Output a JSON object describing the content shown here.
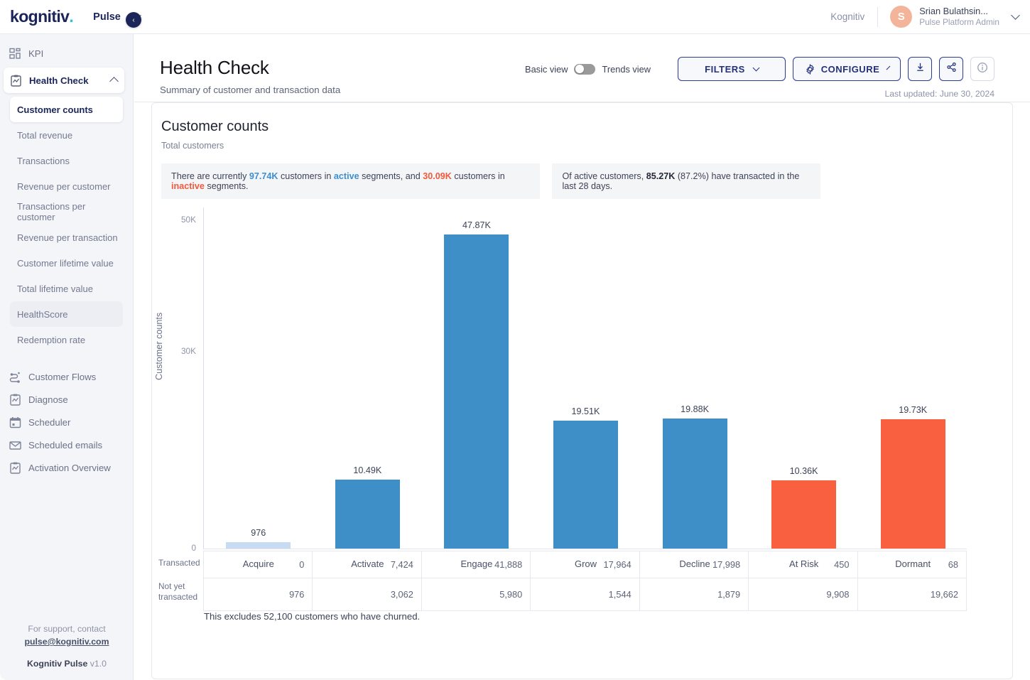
{
  "topbar": {
    "logo_text": "kognitiv",
    "product": "Pulse",
    "org": "Kognitiv",
    "avatar_initial": "S",
    "user_name": "Srian Bulathsin...",
    "user_role": "Pulse Platform Admin"
  },
  "sidebar": {
    "items": [
      {
        "label": "KPI",
        "icon": "grid-icon"
      },
      {
        "label": "Health Check",
        "icon": "clipboard-chart-icon"
      }
    ],
    "subitems": [
      {
        "label": "Customer counts",
        "state": "selected"
      },
      {
        "label": "Total revenue",
        "state": "normal"
      },
      {
        "label": "Transactions",
        "state": "normal"
      },
      {
        "label": "Revenue per customer",
        "state": "normal"
      },
      {
        "label": "Transactions per customer",
        "state": "normal"
      },
      {
        "label": "Revenue per transaction",
        "state": "normal"
      },
      {
        "label": "Customer lifetime value",
        "state": "normal"
      },
      {
        "label": "Total lifetime value",
        "state": "normal"
      },
      {
        "label": "HealthScore",
        "state": "tinted"
      },
      {
        "label": "Redemption rate",
        "state": "normal"
      }
    ],
    "bottom_items": [
      {
        "label": "Customer Flows",
        "icon": "flow-icon"
      },
      {
        "label": "Diagnose",
        "icon": "clipboard-chart-icon"
      },
      {
        "label": "Scheduler",
        "icon": "calendar-icon"
      },
      {
        "label": "Scheduled emails",
        "icon": "envelope-icon"
      },
      {
        "label": "Activation Overview",
        "icon": "clipboard-chart-icon"
      }
    ],
    "footer": {
      "support_line": "For support, contact",
      "support_email": "pulse@kognitiv.com",
      "app_name": "Kognitiv Pulse",
      "version": "v1.0"
    },
    "collapse_glyph": "‹"
  },
  "header": {
    "title": "Health Check",
    "subtitle": "Summary of customer and transaction data",
    "basic_view_label": "Basic view",
    "trends_view_label": "Trends view",
    "filters_label": "FILTERS",
    "configure_label": "CONFIGURE",
    "download_icon": "download-icon",
    "share_icon": "share-icon",
    "info_icon": "info-icon",
    "last_updated": "Last updated: June 30, 2024"
  },
  "card": {
    "title": "Customer counts",
    "subtitle": "Total customers",
    "note1": {
      "p1": "There are currently ",
      "active_count": "97.74K",
      "p2": " customers in ",
      "active_word": "active",
      "p3": " segments, and ",
      "inactive_count": "30.09K",
      "p4": " customers in ",
      "inactive_word": "inactive",
      "p5": " segments."
    },
    "note2": {
      "p1": "Of active customers, ",
      "count": "85.27K",
      "p2": " (87.2%) have transacted in the last 28 days."
    },
    "exclusion_note": "This excludes 52,100 customers who have churned."
  },
  "chart_data": {
    "type": "bar",
    "title": "Customer counts",
    "xlabel": "",
    "ylabel": "Customer counts",
    "ylim": [
      0,
      52000
    ],
    "yticks": [
      0,
      30000,
      50000
    ],
    "ytick_labels": [
      "0",
      "30K",
      "50K"
    ],
    "grid": false,
    "legend": "none",
    "categories": [
      "Acquire",
      "Activate",
      "Engage",
      "Grow",
      "Decline",
      "At Risk",
      "Dormant"
    ],
    "values": [
      976,
      10486,
      47868,
      19508,
      19877,
      10358,
      19730
    ],
    "value_labels": [
      "976",
      "10.49K",
      "47.87K",
      "19.51K",
      "19.88K",
      "10.36K",
      "19.73K"
    ],
    "bar_colors": [
      "#c7dcf2",
      "#3e8fc8",
      "#3e8fc8",
      "#3e8fc8",
      "#3e8fc8",
      "#f9603f",
      "#f9603f"
    ],
    "colors": {
      "active": "#3e8fc8",
      "active_light": "#c7dcf2",
      "inactive": "#f9603f"
    }
  },
  "table": {
    "row_labels": [
      "Transacted",
      "Not yet transacted"
    ],
    "rows": [
      [
        "0",
        "7,424",
        "41,888",
        "17,964",
        "17,998",
        "450",
        "68"
      ],
      [
        "976",
        "3,062",
        "5,980",
        "1,544",
        "1,879",
        "9,908",
        "19,662"
      ]
    ]
  }
}
